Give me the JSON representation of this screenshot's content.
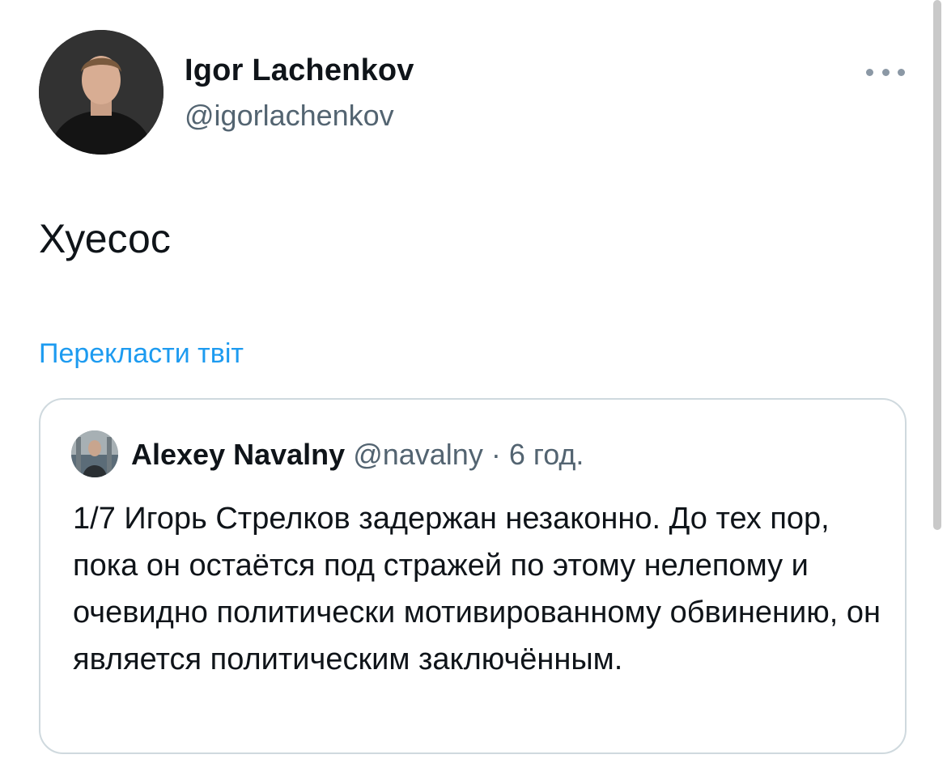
{
  "tweet": {
    "author_name": "Igor Lachenkov",
    "author_handle": "@igorlachenkov",
    "text": "Хуесос",
    "translate_label": "Перекласти твіт",
    "more_icon": "more-horizontal-icon"
  },
  "quoted_tweet": {
    "author_name": "Alexey Navalny",
    "author_handle": "@navalny",
    "separator": " · ",
    "time": "6 год.",
    "text": "1/7 Игорь Стрелков задержан незаконно. До тех пор, пока он остаётся под стражей по этому нелепому и очевидно политически мотивированному обвинению, он является политическим заключённым."
  },
  "colors": {
    "text_primary": "#0f1419",
    "text_secondary": "#536471",
    "link": "#1d9bf0",
    "border": "#cfd9de"
  }
}
